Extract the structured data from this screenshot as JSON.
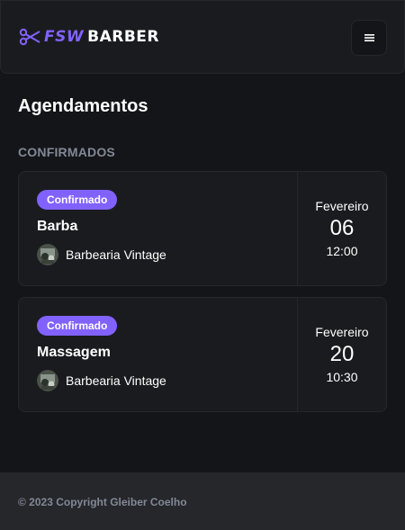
{
  "header": {
    "logo_prefix": "FSW",
    "logo_name": "BARBER",
    "menu_icon": "hamburger-menu-icon"
  },
  "page": {
    "title": "Agendamentos",
    "section_title": "CONFIRMADOS"
  },
  "bookings": [
    {
      "status": "Confirmado",
      "service": "Barba",
      "shop": "Barbearia Vintage",
      "month": "Fevereiro",
      "day": "06",
      "time": "12:00"
    },
    {
      "status": "Confirmado",
      "service": "Massagem",
      "shop": "Barbearia Vintage",
      "month": "Fevereiro",
      "day": "20",
      "time": "10:30"
    }
  ],
  "footer": {
    "copyright": "© 2023 Copyright Gleiber Coelho"
  },
  "colors": {
    "background": "#141518",
    "surface": "#1a1b1f",
    "border": "#26272b",
    "accent": "#8162ff",
    "muted_text": "#838896"
  }
}
